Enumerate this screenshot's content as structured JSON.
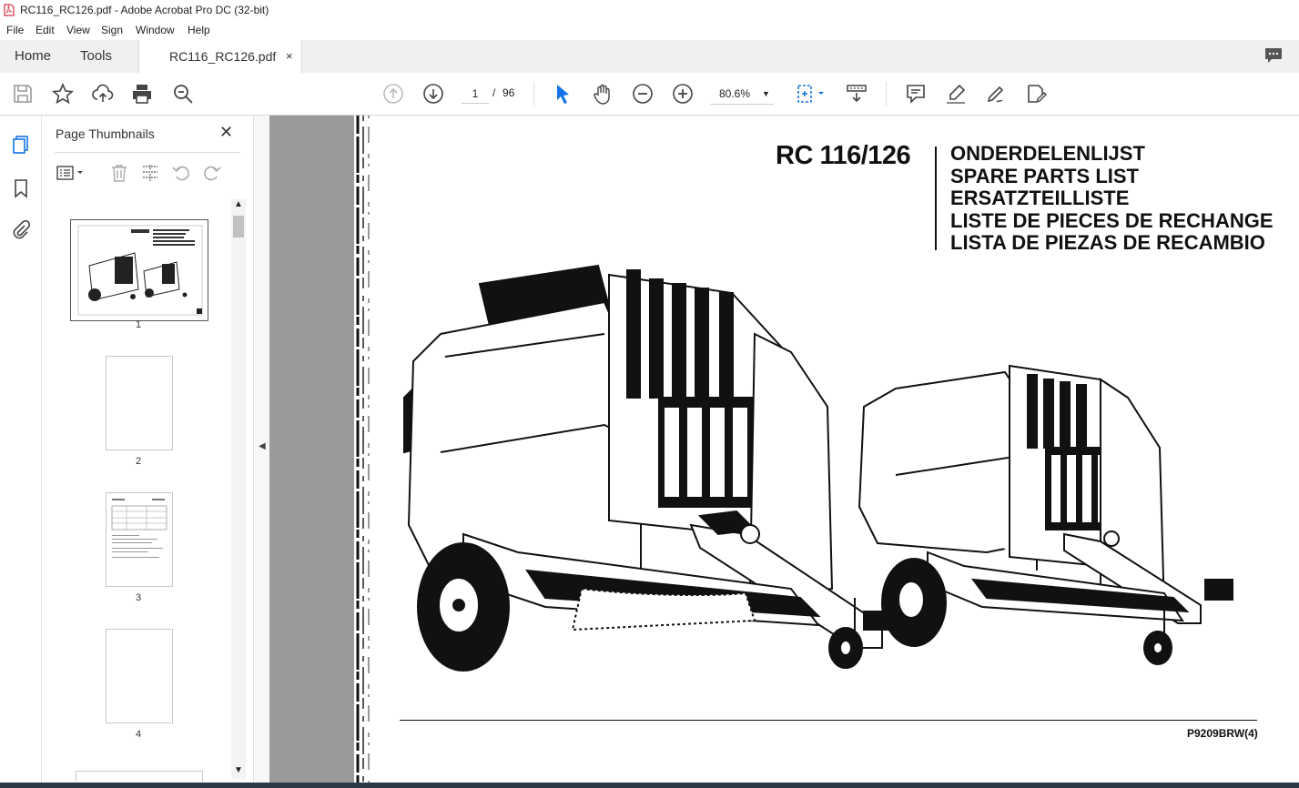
{
  "window": {
    "title": "RC116_RC126.pdf - Adobe Acrobat Pro DC (32-bit)"
  },
  "menu": [
    "File",
    "Edit",
    "View",
    "Sign",
    "Window",
    "Help"
  ],
  "tabs": {
    "home": "Home",
    "tools": "Tools",
    "document": "RC116_RC126.pdf",
    "close": "×"
  },
  "toolbar": {
    "page_current": "1",
    "page_sep": "/",
    "page_total": "96",
    "zoom": "80.6%"
  },
  "panel": {
    "title": "Page Thumbnails",
    "close": "✕",
    "thumbnails": [
      "1",
      "2",
      "3",
      "4"
    ]
  },
  "document": {
    "model": "RC 116/126",
    "titles": [
      "ONDERDELENLIJST",
      "SPARE PARTS LIST",
      "ERSATZTEILLISTE",
      "LISTE DE PIECES DE RECHANGE",
      "LISTA DE PIEZAS DE RECAMBIO"
    ],
    "code": "P9209BRW(4)"
  },
  "colors": {
    "accent_blue": "#1473e6",
    "pdf_red": "#d7373f",
    "canvas_gray": "#9a9a9a"
  }
}
